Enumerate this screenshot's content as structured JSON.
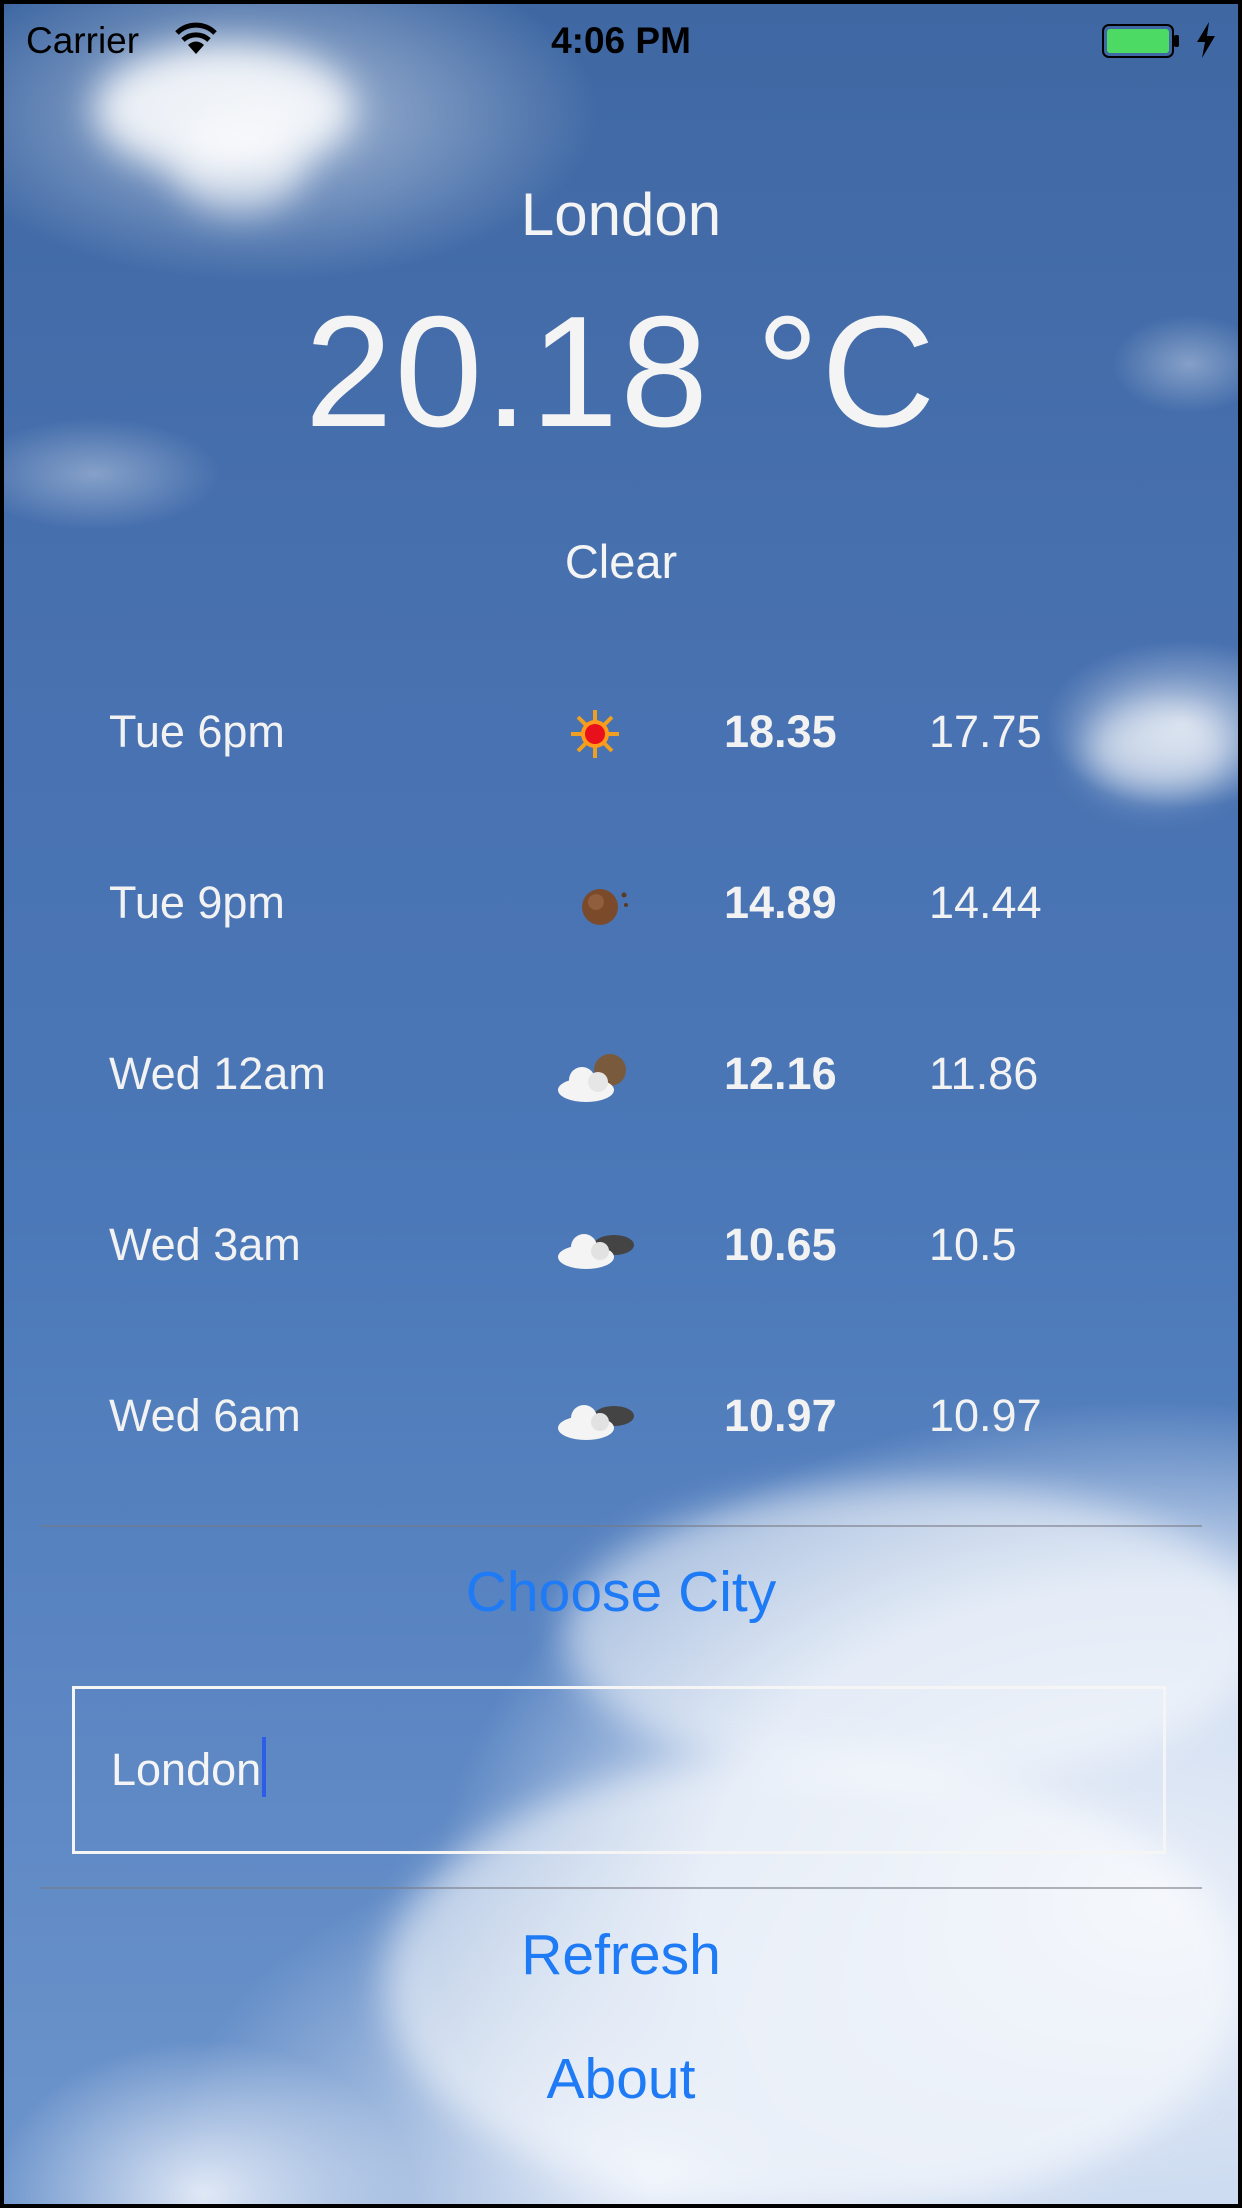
{
  "status_bar": {
    "carrier": "Carrier",
    "time": "4:06 PM",
    "icons": [
      "wifi-icon",
      "battery-icon",
      "charging-bolt-icon"
    ],
    "battery_color": "#4cd964"
  },
  "weather": {
    "city": "London",
    "temperature": "20.18 °C",
    "condition": "Clear"
  },
  "forecast": [
    {
      "time": "Tue 6pm",
      "icon": "sun-icon",
      "high": "18.35",
      "low": "17.75"
    },
    {
      "time": "Tue 9pm",
      "icon": "moon-icon",
      "high": "14.89",
      "low": "14.44"
    },
    {
      "time": "Wed 12am",
      "icon": "cloud-moon-icon",
      "high": "12.16",
      "low": "11.86"
    },
    {
      "time": "Wed 3am",
      "icon": "cloud-night-icon",
      "high": "10.65",
      "low": "10.5"
    },
    {
      "time": "Wed 6am",
      "icon": "cloud-night-icon",
      "high": "10.97",
      "low": "10.97"
    }
  ],
  "controls": {
    "choose_city_label": "Choose City",
    "city_input_value": "London",
    "refresh_label": "Refresh",
    "about_label": "About"
  },
  "colors": {
    "link_blue": "#1e7bf5",
    "text_white": "#f4f4f4",
    "sky_blue": "#4871b0"
  }
}
